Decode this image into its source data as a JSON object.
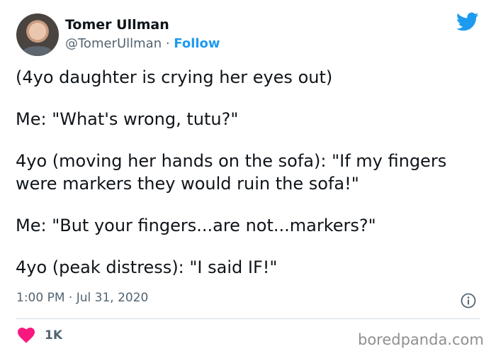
{
  "author": {
    "display_name": "Tomer Ullman",
    "handle": "@TomerUllman",
    "separator": " · ",
    "follow_label": "Follow"
  },
  "tweet": {
    "paragraphs": [
      "(4yo daughter is crying her eyes out)",
      "Me: \"What's wrong, tutu?\"",
      "4yo (moving her hands on the sofa): \"If my fingers were markers they would ruin the sofa!\"",
      "Me: \"But your fingers...are not...markers?\"",
      "4yo (peak distress): \"I said IF!\""
    ],
    "timestamp": "1:00 PM · Jul 31, 2020"
  },
  "engagement": {
    "likes": "1K"
  },
  "watermark": "boredpanda.com",
  "colors": {
    "twitter_blue": "#1d9bf0",
    "like_pink": "#f91880",
    "secondary_text": "#536471"
  },
  "icons": {
    "brand": "twitter-bird-icon",
    "info": "info-icon",
    "like": "heart-icon"
  }
}
